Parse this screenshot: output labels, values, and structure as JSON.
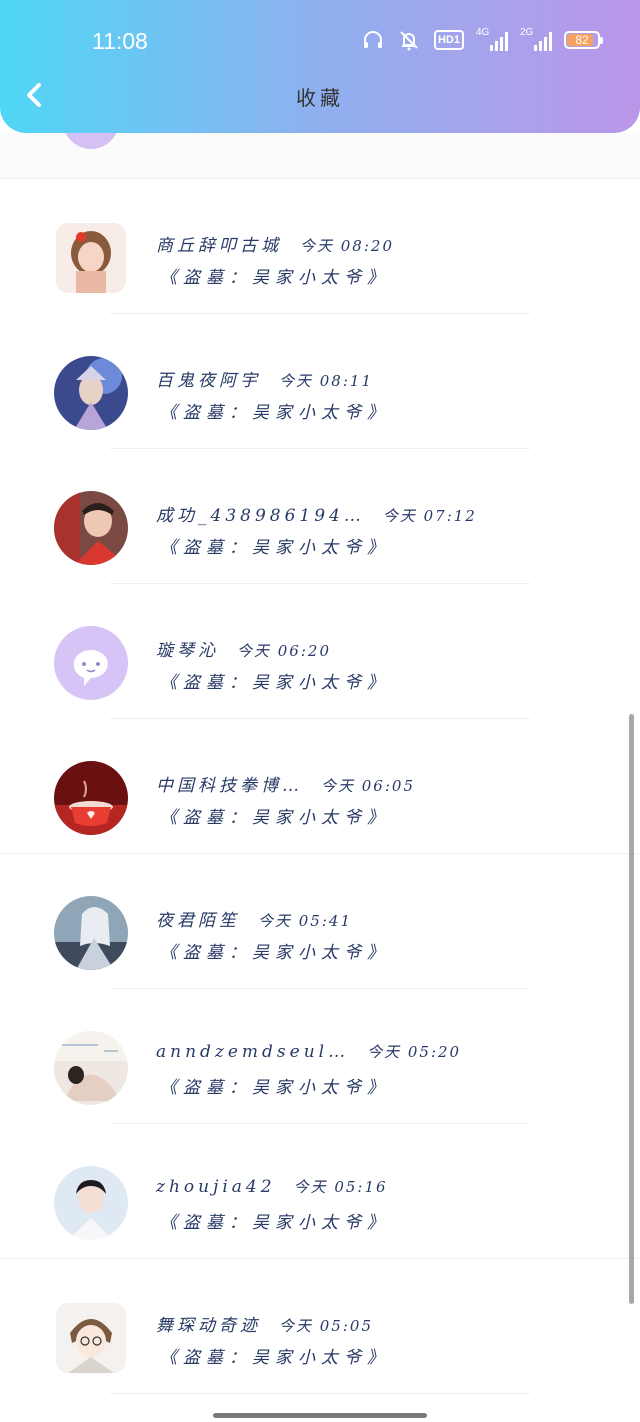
{
  "status_bar": {
    "time": "11:08",
    "hd_label": "HD1",
    "signal1_label": "4G",
    "signal2_label": "2G",
    "battery": "82"
  },
  "header": {
    "title": "收藏"
  },
  "items": [
    {
      "name": "商丘辞叩古城",
      "time": "今天 08:20",
      "fav": "《盗墓：吴家小太爷》"
    },
    {
      "name": "百鬼夜阿宇",
      "time": "今天 08:11",
      "fav": "《盗墓：吴家小太爷》"
    },
    {
      "name": "成功_438986194…",
      "time": "今天 07:12",
      "fav": "《盗墓：吴家小太爷》"
    },
    {
      "name": "璇琴沁",
      "time": "今天 06:20",
      "fav": "《盗墓：吴家小太爷》"
    },
    {
      "name": "中国科技拳博…",
      "time": "今天 06:05",
      "fav": "《盗墓：吴家小太爷》"
    },
    {
      "name": "夜君陌笙",
      "time": "今天 05:41",
      "fav": "《盗墓：吴家小太爷》"
    },
    {
      "name": "anndzemdseul…",
      "time": "今天 05:20",
      "fav": "《盗墓：吴家小太爷》"
    },
    {
      "name": "zhoujia42",
      "time": "今天 05:16",
      "fav": "《盗墓：吴家小太爷》"
    },
    {
      "name": "舞琛动奇迹",
      "time": "今天 05:05",
      "fav": "《盗墓：吴家小太爷》"
    }
  ],
  "colors": {
    "header_start": "#4fd6f6",
    "header_end": "#bb96e9",
    "text": "#283a66",
    "battery": "#f7a25e"
  }
}
